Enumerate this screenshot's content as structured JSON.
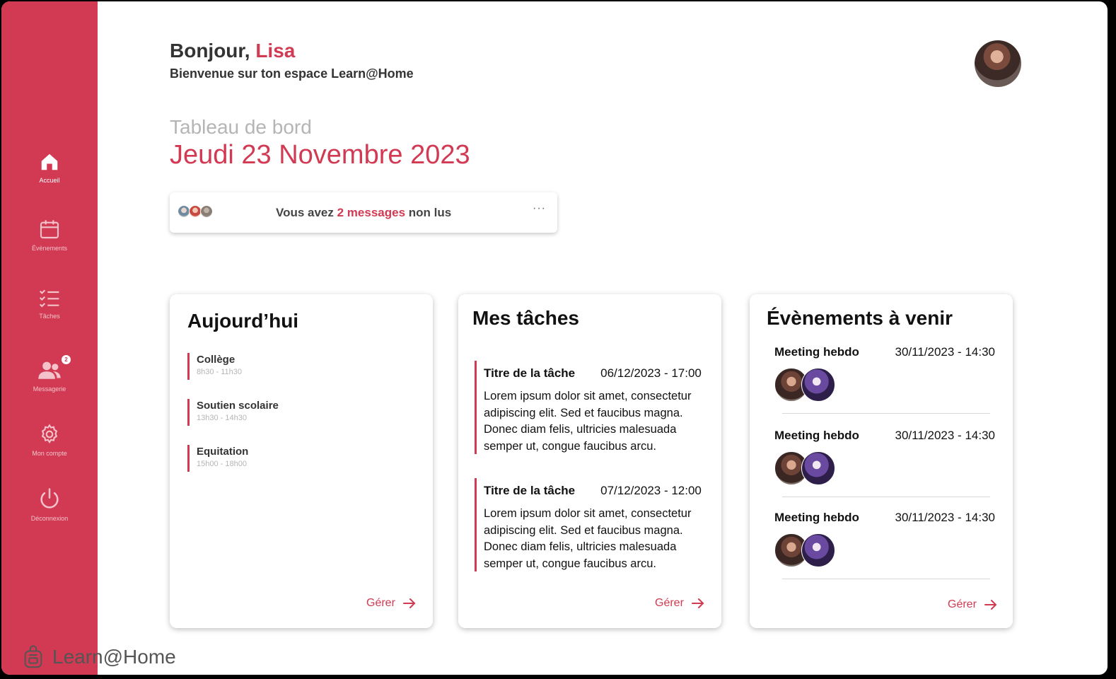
{
  "app": {
    "brand": "Learn@Home"
  },
  "sidebar": {
    "items": [
      {
        "label": "Accueil",
        "icon": "home-icon"
      },
      {
        "label": "Évènements",
        "icon": "calendar-icon"
      },
      {
        "label": "Tâches",
        "icon": "checklist-icon"
      },
      {
        "label": "Messagerie",
        "icon": "users-icon",
        "badge": "2"
      },
      {
        "label": "Mon compte",
        "icon": "gear-icon"
      },
      {
        "label": "Déconnexion",
        "icon": "power-icon"
      }
    ]
  },
  "header": {
    "greeting": "Bonjour, ",
    "name": "Lisa",
    "welcome": "Bienvenue sur ton espace Learn@Home"
  },
  "dashboard": {
    "label": "Tableau de bord",
    "date": "Jeudi 23 Novembre 2023"
  },
  "messages": {
    "prefix": "Vous avez ",
    "count_text": "2 messages",
    "suffix": " non lus",
    "menu": "···"
  },
  "today": {
    "title": "Aujourd’hui",
    "items": [
      {
        "name": "Collège",
        "time": "8h30 - 11h30"
      },
      {
        "name": "Soutien scolaire",
        "time": "13h30 - 14h30"
      },
      {
        "name": "Equitation",
        "time": "15h00 - 18h00"
      }
    ],
    "manage": "Gérer"
  },
  "tasks": {
    "title": "Mes tâches",
    "items": [
      {
        "title": "Titre de la tâche",
        "date": "06/12/2023 - 17:00",
        "body": "Lorem ipsum dolor sit amet, consectetur adipiscing elit. Sed et faucibus magna. Donec diam felis, ultricies malesuada semper ut, congue faucibus arcu."
      },
      {
        "title": "Titre de la tâche",
        "date": "07/12/2023 - 12:00",
        "body": "Lorem ipsum dolor sit amet, consectetur adipiscing elit. Sed et faucibus magna. Donec diam felis, ultricies malesuada semper ut, congue faucibus arcu."
      }
    ],
    "manage": "Gérer"
  },
  "events": {
    "title": "Évènements à venir",
    "items": [
      {
        "name": "Meeting hebdo",
        "date": "30/11/2023 - 14:30"
      },
      {
        "name": "Meeting hebdo",
        "date": "30/11/2023 - 14:30"
      },
      {
        "name": "Meeting hebdo",
        "date": "30/11/2023 - 14:30"
      }
    ],
    "manage": "Gérer"
  },
  "colors": {
    "accent": "#d13a52",
    "muted": "#b5b5b5"
  }
}
